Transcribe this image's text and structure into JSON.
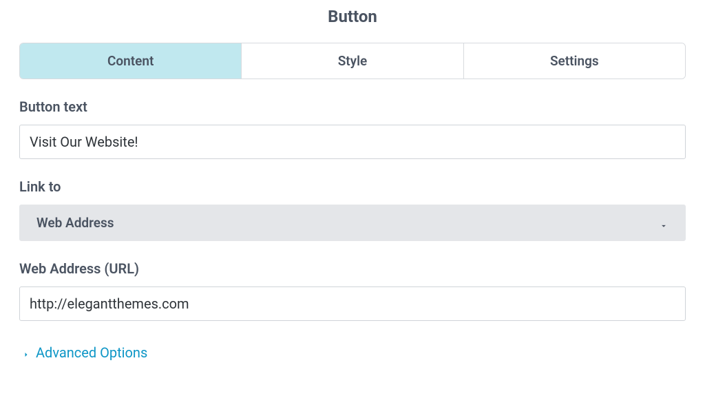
{
  "header": {
    "title": "Button"
  },
  "tabs": [
    {
      "label": "Content",
      "active": true
    },
    {
      "label": "Style",
      "active": false
    },
    {
      "label": "Settings",
      "active": false
    }
  ],
  "fields": {
    "button_text": {
      "label": "Button text",
      "value": "Visit Our Website!"
    },
    "link_to": {
      "label": "Link to",
      "selected": "Web Address"
    },
    "web_address": {
      "label": "Web Address (URL)",
      "value": "http://elegantthemes.com"
    }
  },
  "advanced": {
    "label": "Advanced Options"
  },
  "colors": {
    "active_tab_bg": "#c0e8ef",
    "link": "#0d96c6"
  }
}
